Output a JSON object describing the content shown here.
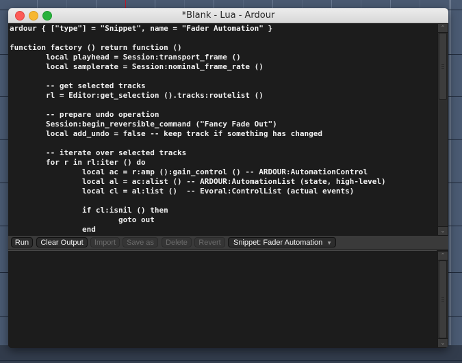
{
  "window": {
    "title": "*Blank - Lua - Ardour"
  },
  "editor": {
    "lines": [
      "ardour { [\"type\"] = \"Snippet\", name = \"Fader Automation\" }",
      "",
      "function factory () return function ()",
      "        local playhead = Session:transport_frame ()",
      "        local samplerate = Session:nominal_frame_rate ()",
      "",
      "        -- get selected tracks",
      "        rl = Editor:get_selection ().tracks:routelist ()",
      "",
      "        -- prepare undo operation",
      "        Session:begin_reversible_command (\"Fancy Fade Out\")",
      "        local add_undo = false -- keep track if something has changed",
      "",
      "        -- iterate over selected tracks",
      "        for r in rl:iter () do",
      "                local ac = r:amp ():gain_control () -- ARDOUR:AutomationControl",
      "                local al = ac:alist () -- ARDOUR:AutomationList (state, high-level)",
      "                local cl = al:list ()  -- Evoral:ControlList (actual events)",
      "",
      "                if cl:isnil () then",
      "                        goto out",
      "                end"
    ]
  },
  "toolbar": {
    "run_label": "Run",
    "clear_output_label": "Clear Output",
    "import_label": "Import",
    "save_as_label": "Save as",
    "delete_label": "Delete",
    "revert_label": "Revert",
    "snippet_selected": "Snippet: Fader Automation"
  },
  "output": {
    "text": ""
  },
  "icons": {
    "scroll_up": "⌃",
    "scroll_down": "⌄",
    "dropdown_caret": "▼"
  },
  "colors": {
    "close": "#fc5b57",
    "minimize": "#f7b731",
    "maximize": "#28b13c",
    "playhead": "#c0182a",
    "editor_bg": "#1c1c1c",
    "editor_text": "#f0f0f0"
  }
}
